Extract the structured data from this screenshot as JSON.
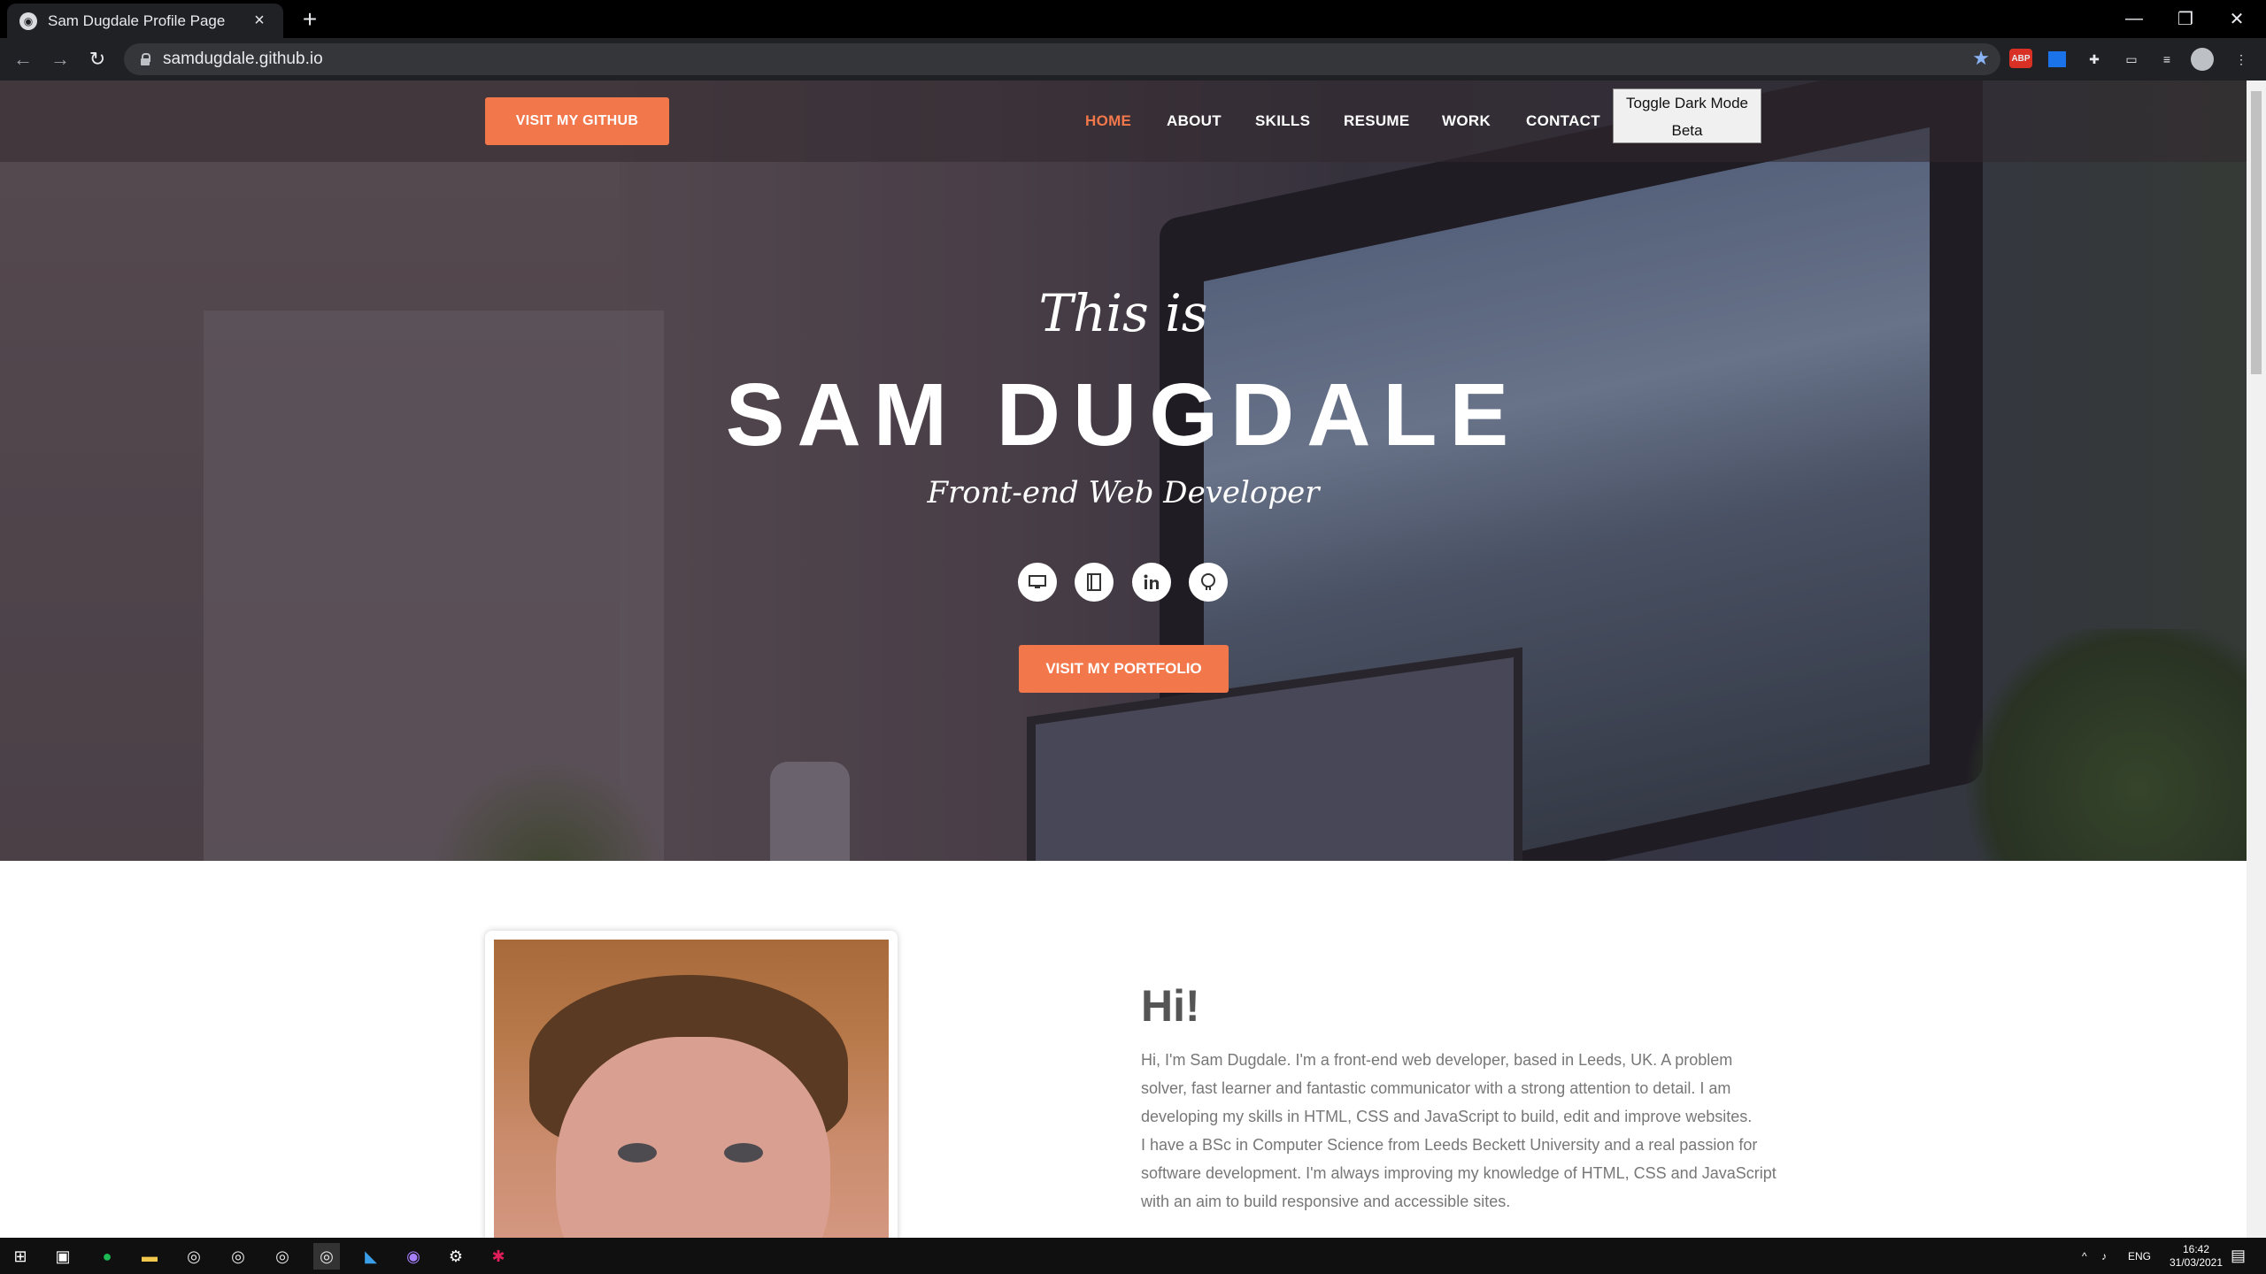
{
  "browser": {
    "tab_title": "Sam Dugdale Profile Page",
    "new_tab": "+",
    "url": "samdugdale.github.io",
    "window_controls": {
      "minimize": "—",
      "restore": "❐",
      "close": "✕"
    },
    "ext_abp": "ABP"
  },
  "site": {
    "github_button": "VISIT MY GITHUB",
    "menu": [
      "HOME",
      "ABOUT",
      "SKILLS",
      "RESUME",
      "WORK",
      "CONTACT"
    ],
    "active_menu": "HOME",
    "dark_mode": {
      "label": "Toggle Dark Mode",
      "sub": "Beta"
    },
    "hero": {
      "intro": "This is",
      "name": "SAM DUGDALE",
      "role": "Front-end Web Developer",
      "portfolio_button": "VISIT MY PORTFOLIO"
    },
    "social_icons": [
      "monitor-icon",
      "notebook-icon",
      "linkedin-icon",
      "github-icon"
    ],
    "about": {
      "heading": "Hi!",
      "paragraph1": "Hi, I'm Sam Dugdale. I'm a front-end web developer, based in Leeds, UK. A problem solver, fast learner and fantastic communicator with a strong attention to detail. I am developing my skills in HTML, CSS and JavaScript to build, edit and improve websites.",
      "paragraph2": "I have a BSc in Computer Science from Leeds Beckett University and a real passion for software development. I'm always improving my knowledge of HTML, CSS and JavaScript with an aim to build responsive and accessible sites."
    }
  },
  "taskbar": {
    "lang": "ENG",
    "time": "16:42",
    "date": "31/03/2021"
  },
  "colors": {
    "accent": "#f2774a",
    "heading": "#555555",
    "body_text": "#777777"
  }
}
